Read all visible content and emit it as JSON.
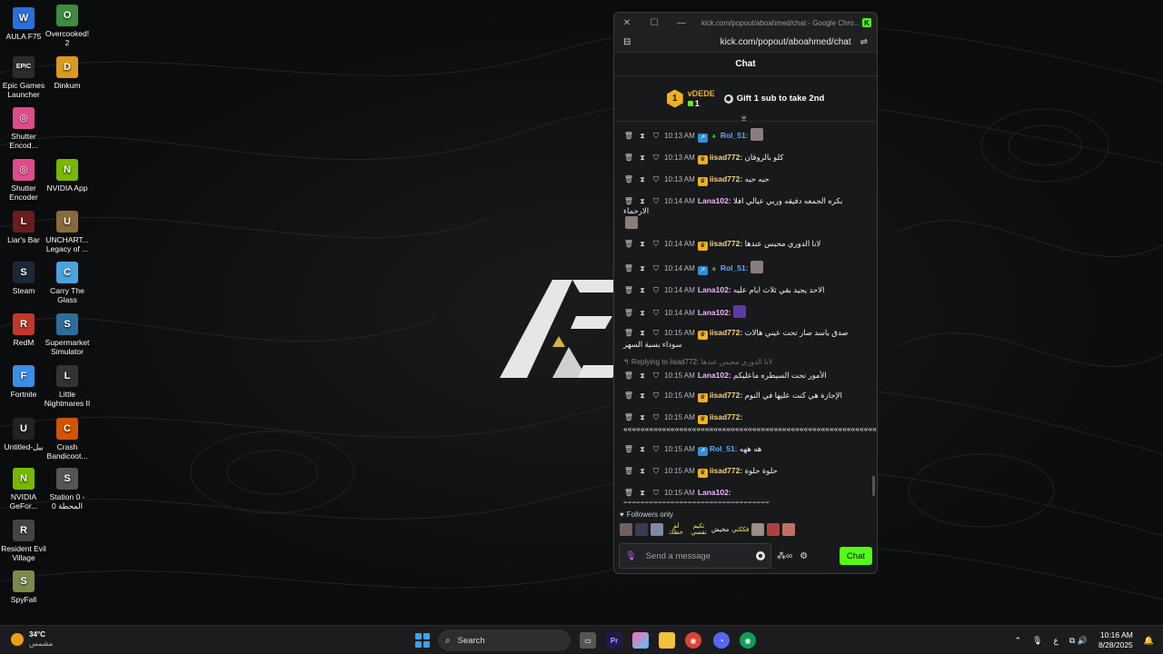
{
  "desktop": {
    "icons": [
      {
        "label": "AULA F75",
        "color": "#2a6fdb",
        "glyph": "W"
      },
      {
        "label": "Overcooked! 2",
        "color": "#3b8f3c",
        "glyph": "O"
      },
      {
        "label": "Epic Games Launcher",
        "color": "#2b2b2b",
        "glyph": "EPIC"
      },
      {
        "label": "Dinkum",
        "color": "#d99a1e",
        "glyph": "D"
      },
      {
        "label": "Shutter Encod...",
        "color": "#e04b8a",
        "glyph": "◎"
      },
      {
        "label": "Shutter Encoder",
        "color": "#e04b8a",
        "glyph": "◎"
      },
      {
        "label": "NVIDIA App",
        "color": "#76b900",
        "glyph": "N"
      },
      {
        "label": "Liar's Bar",
        "color": "#6b1d1d",
        "glyph": "L"
      },
      {
        "label": "UNCHART... Legacy of ...",
        "color": "#8a6a3a",
        "glyph": "U"
      },
      {
        "label": "Steam",
        "color": "#1b2838",
        "glyph": "S"
      },
      {
        "label": "Carry The Glass",
        "color": "#4aa3df",
        "glyph": "C"
      },
      {
        "label": "RedM",
        "color": "#c0392b",
        "glyph": "R"
      },
      {
        "label": "Supermarket Simulator",
        "color": "#2c6e9b",
        "glyph": "S"
      },
      {
        "label": "Fortnite",
        "color": "#3a8ee6",
        "glyph": "F"
      },
      {
        "label": "Little Nightmares II",
        "color": "#333",
        "glyph": "L"
      },
      {
        "label": "Untitled-بيل",
        "color": "#222",
        "glyph": "U"
      },
      {
        "label": "Crash Bandicoot...",
        "color": "#d35400",
        "glyph": "C"
      },
      {
        "label": "NVIDIA GeFor...",
        "color": "#76b900",
        "glyph": "N"
      },
      {
        "label": "Station 0 - المحطة 0",
        "color": "#555",
        "glyph": "S"
      },
      {
        "label": "Resident Evil Village",
        "color": "#444",
        "glyph": "R"
      },
      {
        "label": "SpyFall",
        "color": "#7a8a4a",
        "glyph": "S"
      }
    ]
  },
  "window": {
    "title": "kick.com/popout/aboahmed/chat - Google Chro...",
    "url": "kick.com/popout/aboahmed/chat",
    "kick_badge": "K"
  },
  "chat": {
    "header": "Chat",
    "leaderboard": {
      "rank": "1",
      "user": "vDEDE",
      "count": "1"
    },
    "gift_cta": "Gift 1 sub to take 2nd",
    "messages": [
      {
        "time": "10:13 AM",
        "badges": [
          "sub",
          "gift"
        ],
        "user": "Rol_51",
        "user_color": "blue",
        "text": "",
        "emote": true
      },
      {
        "time": "10:13 AM",
        "badges": [
          "crown"
        ],
        "user": "iisad772",
        "user_color": "gold",
        "text": "كلو بالروقان"
      },
      {
        "time": "10:13 AM",
        "badges": [
          "crown"
        ],
        "user": "iisad772",
        "user_color": "gold",
        "text": "حبه حبه"
      },
      {
        "time": "10:14 AM",
        "badges": [],
        "user": "Lana102",
        "user_color": "pink",
        "text": "بكره الجمعه دقيقه وربي عيالي افلا الارحماء",
        "emote_after": true
      },
      {
        "time": "10:14 AM",
        "badges": [
          "crown"
        ],
        "user": "iisad772",
        "user_color": "gold",
        "text": "لانا الدوري محبس عندها"
      },
      {
        "time": "10:14 AM",
        "badges": [
          "sub",
          "gift"
        ],
        "user": "Rol_51",
        "user_color": "blue",
        "text": "",
        "emote": true
      },
      {
        "time": "10:14 AM",
        "badges": [],
        "user": "Lana102",
        "user_color": "pink",
        "text": "الاحد يجيد بقي ثلاث ايام عليه"
      },
      {
        "time": "10:14 AM",
        "badges": [],
        "user": "Lana102",
        "user_color": "pink",
        "text": "",
        "emote": true,
        "emote_purple": true
      },
      {
        "time": "10:15 AM",
        "badges": [
          "crown"
        ],
        "user": "iisad772",
        "user_color": "gold",
        "text": "صدق ياسد صار تحت عيني هالات سوداء بسبة السهر"
      },
      {
        "reply_to": "Replying to iisad772:",
        "reply_quote": "لانا الدوري محبس عندها",
        "time": "10:15 AM",
        "badges": [],
        "user": "Lana102",
        "user_color": "pink",
        "text": "الأمور تحت السيطره ماعليكم"
      },
      {
        "time": "10:15 AM",
        "badges": [
          "crown"
        ],
        "user": "iisad772",
        "user_color": "gold",
        "text": "الإجازة هي كنت عليها في النوم"
      },
      {
        "time": "10:15 AM",
        "badges": [
          "crown"
        ],
        "user": "iisad772",
        "user_color": "gold",
        "text": "«««««««««««««««««««««««««««««««««««««««««««««««««««««««««««««««««"
      },
      {
        "time": "10:15 AM",
        "badges": [
          "sub"
        ],
        "user": "Rol_51",
        "user_color": "blue",
        "text": "هه ههه"
      },
      {
        "time": "10:15 AM",
        "badges": [
          "crown"
        ],
        "user": "iisad772",
        "user_color": "gold",
        "text": "حلوة حلوة"
      },
      {
        "time": "10:15 AM",
        "badges": [],
        "user": "Lana102",
        "user_color": "pink",
        "text": "««««««««««««««««««««««««««««««««««"
      }
    ],
    "followers_only": "Followers only",
    "emote_texts": [
      "لم حطك",
      "تكيم نفسي",
      "محيش",
      "فككني"
    ],
    "input_placeholder": "Send a message",
    "chat_button": "Chat"
  },
  "taskbar": {
    "weather_temp": "34°C",
    "weather_desc": "مشمس",
    "search_label": "Search",
    "language": "ع",
    "time": "10:16 AM",
    "date": "8/28/2025"
  }
}
